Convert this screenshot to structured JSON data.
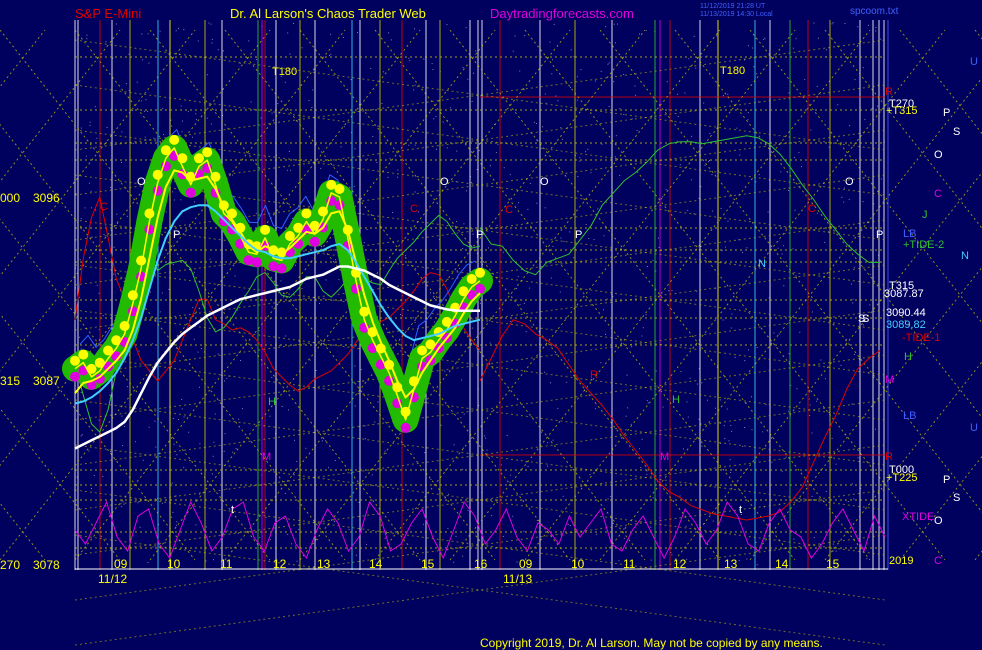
{
  "header": {
    "instrument": "S&P E-Mini",
    "author": "Dr. Al Larson's Chaos Trader Web",
    "site": "Daytradingforecasts.com",
    "stamp1": "11/12/2019 21:28 UT",
    "stamp2": "11/13/2019 14:30 Local",
    "stamp3": "spcoom.txt"
  },
  "footer": {
    "copyright": "Copyright 2019, Dr. Al Larson. May not be copied by any means."
  },
  "colors": {
    "background": "#00005e",
    "grid_yellow": "#c8c800",
    "price_yellow": "#ffff00",
    "green_band": "#22bb00",
    "magenta": "#e000e0",
    "cyan": "#40d0ff",
    "white": "#ffffff",
    "red": "#e00000",
    "green_line": "#30c030",
    "blue_line": "#3060ff"
  },
  "chart_data": {
    "type": "line",
    "title": "S&P E-Mini",
    "y_axis_labels": [
      {
        "left": "000",
        "price": "3096"
      },
      {
        "left": "315",
        "price": "3087"
      },
      {
        "left": "270",
        "price": "3078"
      }
    ],
    "ylim": [
      3078,
      3099
    ],
    "x_axis": {
      "day1": "11/12",
      "day2": "11/13",
      "hours_day1": [
        "09",
        "10",
        "11",
        "12",
        "13",
        "14",
        "15",
        "16"
      ],
      "hours_day2": [
        "09",
        "10",
        "11",
        "12",
        "13",
        "14",
        "15"
      ]
    },
    "values_box": {
      "v1": "3090.44",
      "v2": "3089.82",
      "v3": "3087.87"
    },
    "chart_letters": [
      "O",
      "P",
      "C",
      "H",
      "M",
      "L",
      "R",
      "T180",
      "N",
      "S"
    ],
    "right_labels": [
      {
        "text": "U",
        "color": "#4060ff"
      },
      {
        "text": "R",
        "color": "#e00000"
      },
      {
        "text": "T270",
        "color": "#ffffff"
      },
      {
        "text": "+T315",
        "color": "#ffff00"
      },
      {
        "text": "P",
        "color": "#ffffff"
      },
      {
        "text": "S",
        "color": "#ffffff"
      },
      {
        "text": "O",
        "color": "#ffffff"
      },
      {
        "text": "C",
        "color": "#e000e0"
      },
      {
        "text": "J",
        "color": "#30c030"
      },
      {
        "text": "LB",
        "color": "#4060ff"
      },
      {
        "text": "+TIDE-2",
        "color": "#30c030"
      },
      {
        "text": "N",
        "color": "#40d0ff"
      },
      {
        "text": "T315",
        "color": "#ffffff"
      },
      {
        "text": "3087.87",
        "color": "#ffffff"
      },
      {
        "text": "3090.44",
        "color": "#ffffff"
      },
      {
        "text": "3089.82",
        "color": "#40d0ff"
      },
      {
        "text": "S",
        "color": "#ffffff"
      },
      {
        "text": "-TIDE-1",
        "color": "#e00000"
      },
      {
        "text": "H",
        "color": "#30c030"
      },
      {
        "text": "M",
        "color": "#e000e0"
      },
      {
        "text": "LB",
        "color": "#4060ff"
      },
      {
        "text": "U",
        "color": "#4060ff"
      },
      {
        "text": "R",
        "color": "#e00000"
      },
      {
        "text": "T000",
        "color": "#ffffff"
      },
      {
        "text": "+T225",
        "color": "#ffff00"
      },
      {
        "text": "P",
        "color": "#ffffff"
      },
      {
        "text": "S",
        "color": "#ffffff"
      },
      {
        "text": "XTIDE",
        "color": "#e000e0"
      },
      {
        "text": "O",
        "color": "#ffffff"
      },
      {
        "text": "2019",
        "color": "#ffff00"
      },
      {
        "text": "C",
        "color": "#e000e0"
      }
    ],
    "series": [
      {
        "name": "Price",
        "color": "#ffff00",
        "values": [
          3087.6,
          3087.9,
          3087.2,
          3087.5,
          3088.1,
          3088.6,
          3089.3,
          3090.8,
          3092.5,
          3094.8,
          3096.7,
          3097.9,
          3098.4,
          3097.5,
          3096.6,
          3097.5,
          3097.8,
          3096.6,
          3095.2,
          3094.8,
          3094.1,
          3093.3,
          3093.2,
          3094.0,
          3093.0,
          3092.9,
          3093.7,
          3094.1,
          3094.8,
          3094.2,
          3094.9,
          3096.2,
          3096.0,
          3094.0,
          3091.9,
          3090.0,
          3089.0,
          3088.2,
          3087.4,
          3086.3,
          3085.1,
          3086.6,
          3088.1,
          3088.4,
          3089.0,
          3089.5,
          3090.2,
          3091.0,
          3091.6,
          3091.9
        ]
      },
      {
        "name": "Fast MA",
        "color": "#ffff00",
        "values": [
          3086.4,
          3086.9,
          3087.0,
          3087.2,
          3087.6,
          3088.0,
          3088.5,
          3089.5,
          3091.0,
          3093.0,
          3095.0,
          3096.5,
          3097.3,
          3097.2,
          3096.8,
          3096.9,
          3097.0,
          3096.4,
          3095.5,
          3094.9,
          3094.3,
          3093.6,
          3093.3,
          3093.6,
          3093.4,
          3093.2,
          3093.5,
          3093.9,
          3094.3,
          3094.2,
          3094.5,
          3095.2,
          3095.3,
          3094.4,
          3092.8,
          3091.2,
          3089.9,
          3088.9,
          3088.0,
          3087.0,
          3086.2,
          3086.6,
          3087.4,
          3088.0,
          3088.6,
          3089.1,
          3089.6,
          3090.3,
          3090.9,
          3091.3
        ]
      },
      {
        "name": "Medium MA",
        "color": "#40d0ff",
        "values": [
          3085.9,
          3086.0,
          3086.2,
          3086.5,
          3086.9,
          3087.4,
          3088.1,
          3089.0,
          3090.1,
          3091.5,
          3092.9,
          3094.0,
          3094.8,
          3095.3,
          3095.5,
          3095.6,
          3095.6,
          3095.3,
          3094.9,
          3094.5,
          3094.1,
          3093.7,
          3093.4,
          3093.3,
          3093.1,
          3093.0,
          3093.0,
          3093.1,
          3093.2,
          3093.3,
          3093.4,
          3093.6,
          3093.7,
          3093.4,
          3092.8,
          3092.1,
          3091.4,
          3090.7,
          3090.1,
          3089.6,
          3089.2,
          3089.0,
          3089.1,
          3089.2,
          3089.3,
          3089.5,
          3089.7,
          3089.8,
          3089.9,
          3090.0
        ]
      },
      {
        "name": "Slow MA",
        "color": "#ffffff",
        "values": [
          3083.7,
          3083.9,
          3084.1,
          3084.3,
          3084.5,
          3084.7,
          3085.0,
          3085.6,
          3086.4,
          3087.2,
          3087.9,
          3088.4,
          3088.9,
          3089.3,
          3089.6,
          3089.9,
          3090.2,
          3090.4,
          3090.6,
          3090.8,
          3091.0,
          3091.1,
          3091.2,
          3091.3,
          3091.4,
          3091.5,
          3091.6,
          3091.8,
          3092.0,
          3092.1,
          3092.2,
          3092.4,
          3092.6,
          3092.6,
          3092.5,
          3092.4,
          3092.2,
          3092.0,
          3091.7,
          3091.5,
          3091.3,
          3091.1,
          3090.9,
          3090.7,
          3090.6,
          3090.5,
          3090.45,
          3090.44,
          3090.44,
          3090.44
        ]
      },
      {
        "name": "TIDE-1",
        "color": "#e00000",
        "values": [
          3090,
          3093,
          3095,
          3096,
          3094,
          3092,
          3091,
          3089,
          3088,
          3087.5,
          3087.0,
          3087.5,
          3088,
          3089,
          3090,
          3091,
          3091,
          3090,
          3089.8,
          3089.5,
          3089.6,
          3089.4,
          3089.0,
          3088.4,
          3087.6,
          3087.2,
          3086.8,
          3086.5,
          3086.7,
          3087.1,
          3087.3,
          3087.5,
          3087.9,
          3088.3,
          3088.9,
          3089.4,
          3089.7,
          3089.9,
          3090.1,
          3090.5,
          3090.9,
          3091.4,
          3092.0,
          3092.3,
          3092.2,
          3091.5,
          3090.5,
          3089.6,
          3089.0,
          3088.5
        ]
      },
      {
        "name": "TIDE-2",
        "color": "#30c030",
        "values": [
          3087.8,
          3086.3,
          3084.9,
          3084.5,
          3085.6,
          3087.5,
          3090.2,
          3092.4,
          3093.4,
          3093.2,
          3092.4,
          3092.7,
          3092.8,
          3092.9,
          3092.5,
          3091.4,
          3090.1,
          3089.4,
          3089.6,
          3090.1,
          3090.8,
          3091.4,
          3092.1,
          3092.3,
          3091.8,
          3091.2,
          3091.1,
          3091.5,
          3092.1,
          3092.1,
          3091.4,
          3091.1,
          3091.5,
          3092.0,
          3092.3,
          3092.0,
          3091.8,
          3091.7,
          3092.4,
          3093.0,
          3093.4,
          3093.8,
          3094.3,
          3094.7,
          3095.1,
          3094.8,
          3094.2,
          3093.7,
          3093.5,
          3093.6
        ]
      },
      {
        "name": "TIDE-2 (day 2)",
        "color": "#30c030",
        "values": [
          3094.5,
          3093.7,
          3093.6,
          3092.9,
          3092.4,
          3092.2,
          3092.8,
          3093.0,
          3093.2,
          3093.9,
          3094.6,
          3095.6,
          3096.2,
          3096.8,
          3097.2,
          3097.7,
          3098.3,
          3098.6,
          3098.7,
          3098.7,
          3098.6,
          3098.7,
          3098.8,
          3098.9,
          3099.0,
          3098.9,
          3098.6,
          3098.1,
          3097.4,
          3096.6,
          3095.9,
          3095.1,
          3094.4,
          3093.7,
          3093.2,
          3092.8,
          3092.8
        ]
      },
      {
        "name": "TIDE-1 (day 2)",
        "color": "#e00000",
        "values": [
          3087.0,
          3088.1,
          3089.2,
          3090.0,
          3089.8,
          3089.3,
          3089.0,
          3088.6,
          3087.8,
          3087.0,
          3086.4,
          3085.8,
          3085.1,
          3084.3,
          3083.6,
          3082.9,
          3082.1,
          3081.6,
          3081.3,
          3080.9,
          3080.7,
          3080.5,
          3080.4,
          3080.3,
          3080.2,
          3080.3,
          3080.4,
          3080.6,
          3081.1,
          3081.8,
          3083.0,
          3084.2,
          3085.3,
          3086.6,
          3087.6,
          3088.1,
          3088.5
        ]
      }
    ],
    "xtide": [
      0.5,
      0.3,
      0.6,
      0.9,
      0.4,
      0.2,
      0.7,
      0.8,
      0.3,
      0.1,
      0.5,
      0.9,
      0.6,
      0.2,
      0.4,
      0.8,
      0.9,
      0.4,
      0.2,
      0.6,
      0.7,
      0.3,
      0.1,
      0.5,
      0.8,
      0.6,
      0.2,
      0.4,
      0.9,
      0.7,
      0.2,
      0.3,
      0.6,
      0.8,
      0.4,
      0.1,
      0.5,
      0.9,
      0.7,
      0.3,
      0.5,
      0.8,
      0.4,
      0.2,
      0.6,
      0.5,
      0.3,
      0.7,
      0.4,
      0.6,
      0.8,
      0.3,
      0.2,
      0.5,
      0.7,
      0.4,
      0.1,
      0.4,
      0.8,
      0.6,
      0.3,
      0.5,
      0.9,
      0.7,
      0.3,
      0.2,
      0.6,
      0.8,
      0.5,
      0.4,
      0.1,
      0.3,
      0.6,
      0.8,
      0.5,
      0.2,
      0.7,
      0.4
    ]
  }
}
